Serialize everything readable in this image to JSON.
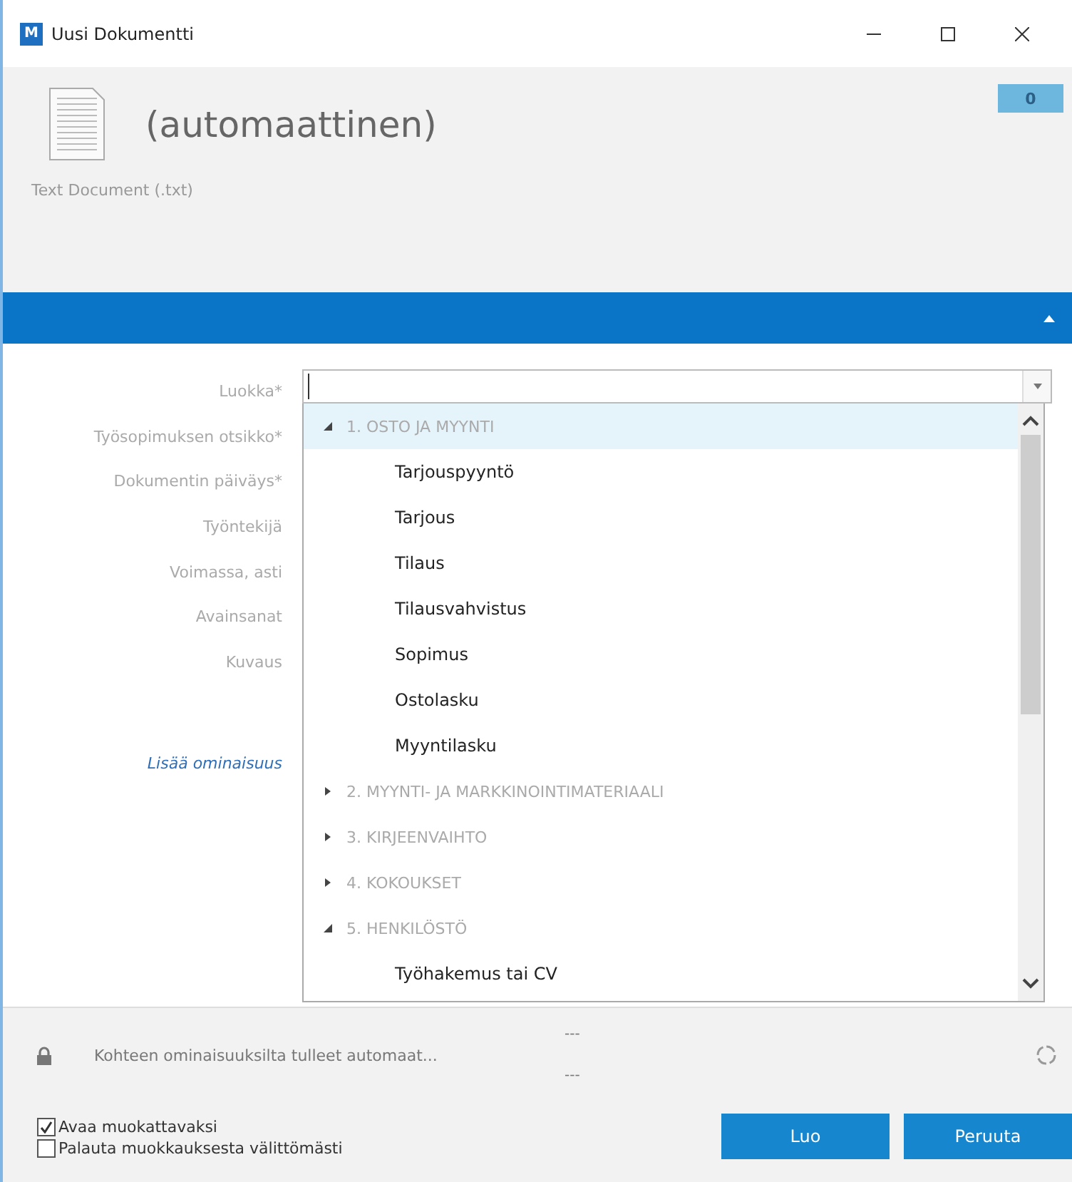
{
  "window": {
    "title": "Uusi Dokumentti",
    "app_badge": "M"
  },
  "header": {
    "name": "(automaattinen)",
    "type": "Text Document (.txt)",
    "comment_count": "0"
  },
  "form": {
    "labels": [
      "Luokka*",
      "Työsopimuksen otsikko*",
      "Dokumentin päiväys*",
      "Työntekijä",
      "Voimassa, asti",
      "Avainsanat",
      "Kuvaus"
    ],
    "add_property_link": "Lisää ominaisuus",
    "category_tree": [
      {
        "label": "1. OSTO JA MYYNTI",
        "expanded": true,
        "selected": true,
        "children": [
          {
            "label": "Tarjouspyyntö"
          },
          {
            "label": "Tarjous"
          },
          {
            "label": "Tilaus"
          },
          {
            "label": "Tilausvahvistus"
          },
          {
            "label": "Sopimus"
          },
          {
            "label": "Ostolasku"
          },
          {
            "label": "Myyntilasku"
          }
        ]
      },
      {
        "label": "2. MYYNTI- JA MARKKINOINTIMATERIAALI",
        "expanded": false,
        "selected": false
      },
      {
        "label": "3. KIRJEENVAIHTO",
        "expanded": false,
        "selected": false
      },
      {
        "label": "4. KOKOUKSET",
        "expanded": false,
        "selected": false
      },
      {
        "label": "5. HENKILÖSTÖ",
        "expanded": true,
        "selected": false,
        "children": [
          {
            "label": "Työhakemus tai CV"
          }
        ]
      }
    ]
  },
  "status": {
    "text": "Kohteen ominaisuuksilta tulleet automaat...",
    "value_top": "---",
    "value_bottom": "---"
  },
  "options": [
    {
      "label": "Avaa muokattavaksi",
      "checked": true
    },
    {
      "label": "Palauta muokkauksesta välittömästi",
      "checked": false
    }
  ],
  "buttons": [
    "Luo",
    "Peruuta"
  ]
}
